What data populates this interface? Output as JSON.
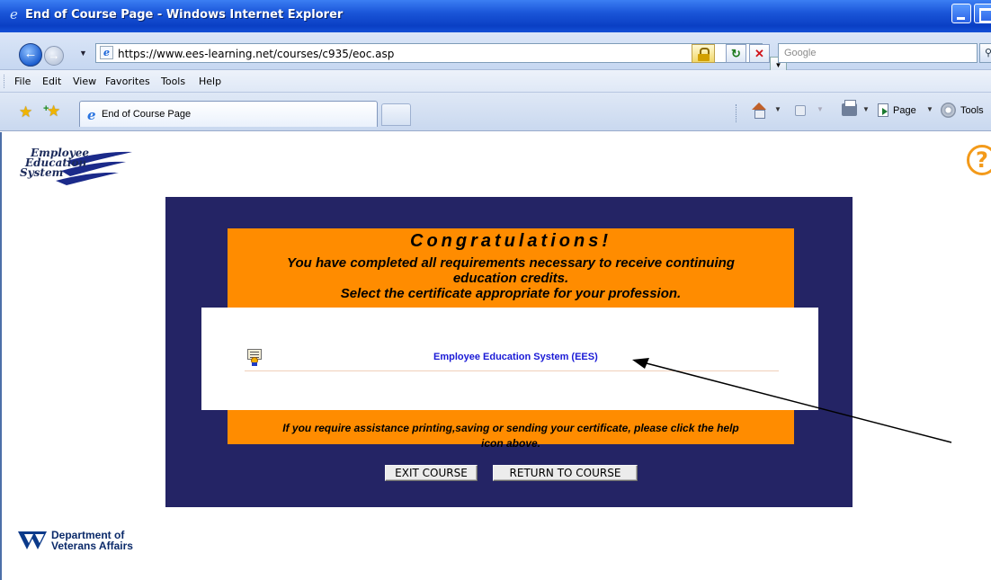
{
  "window": {
    "title": "End of Course Page - Windows Internet Explorer"
  },
  "address_bar": {
    "url": "https://www.ees-learning.net/courses/c935/eoc.asp",
    "search_placeholder": "Google"
  },
  "menu": {
    "items": [
      "File",
      "Edit",
      "View",
      "Favorites",
      "Tools",
      "Help"
    ]
  },
  "tabs": {
    "active_label": "End of Course Page"
  },
  "command_bar": {
    "page_label": "Page",
    "tools_label": "Tools"
  },
  "page": {
    "logo_lines": [
      "Employee",
      "Education",
      "System"
    ],
    "congrats_title": "Congratulations!",
    "completed_line1": "You have completed all requirements necessary to receive continuing",
    "completed_line2": "education credits.",
    "select_line": "Select the certificate appropriate for your profession.",
    "certificate_link": "Employee Education System (EES)",
    "assist_line1": "If you require assistance printing,saving or sending your certificate, please click the help",
    "assist_line2": "icon above.",
    "exit_button": "EXIT COURSE",
    "return_button": "RETURN TO COURSE",
    "va_line1": "Department of",
    "va_line2": "Veterans Affairs",
    "help_glyph": "?"
  },
  "colors": {
    "navy_panel": "#242465",
    "orange_panel": "#ff8c00",
    "link_blue": "#1a1ad6",
    "help_orange": "#f39a1a",
    "titlebar_blue": "#0a3fc4"
  }
}
